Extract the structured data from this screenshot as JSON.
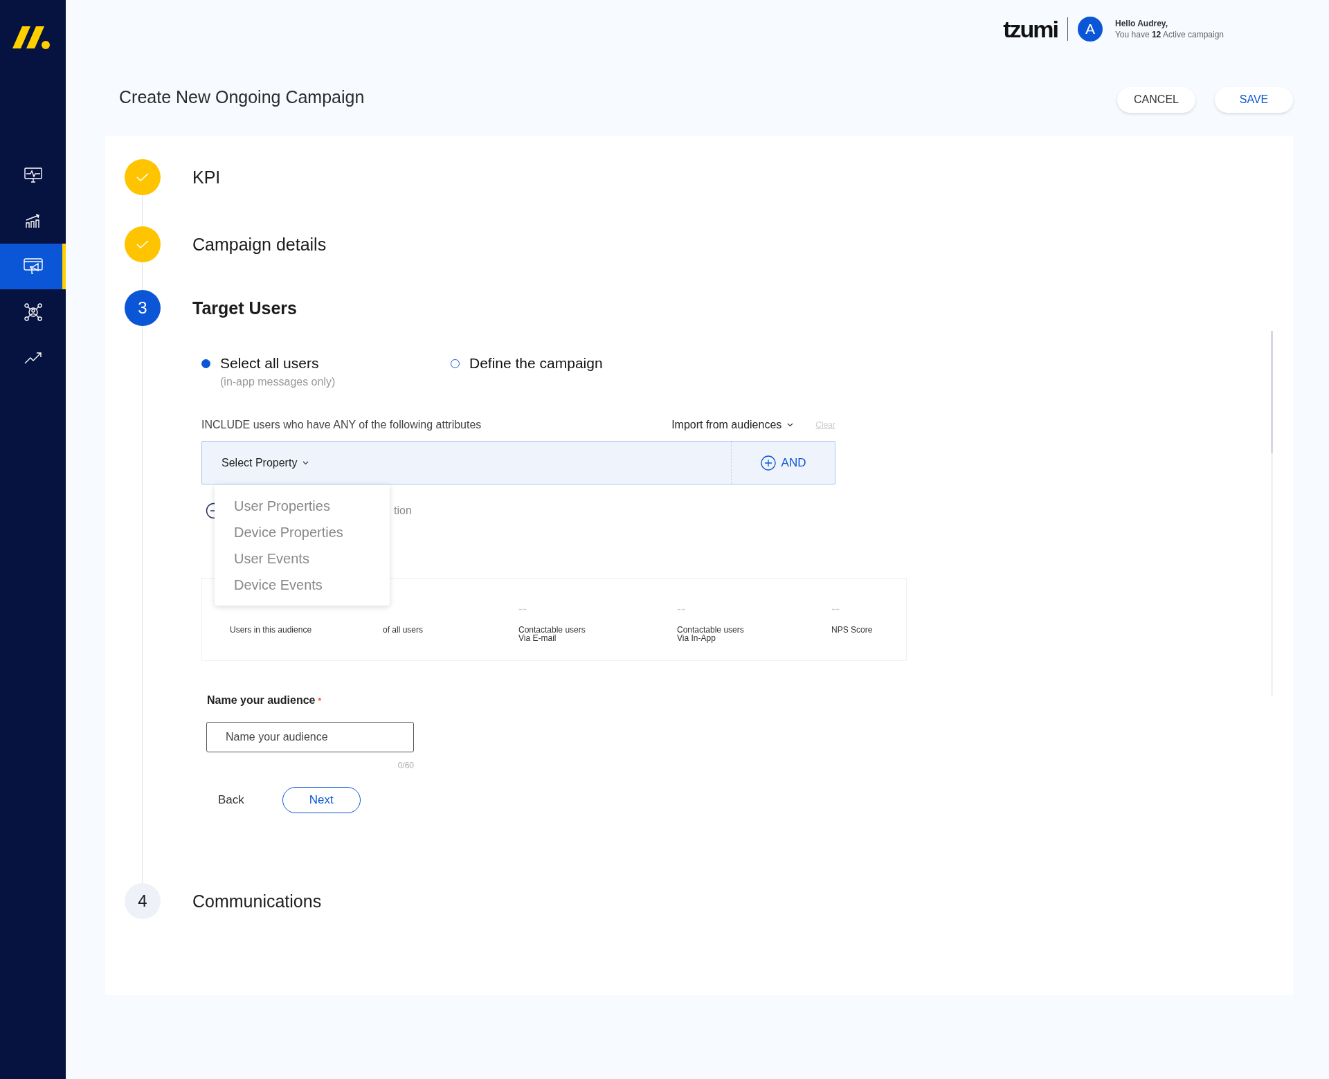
{
  "sidebar": {
    "items": [
      {
        "kind": "monitor",
        "selected": false
      },
      {
        "kind": "chart",
        "selected": false
      },
      {
        "kind": "campaign",
        "selected": true
      },
      {
        "kind": "network",
        "selected": false
      },
      {
        "kind": "trend",
        "selected": false
      }
    ]
  },
  "header": {
    "logo": "tzumi",
    "avatar": "A",
    "greeting": "Hello Audrey,",
    "status": "You have **12** Active campaign"
  },
  "page": {
    "title": "Create New Ongoing Campaign",
    "buttons": [
      {
        "label": "CANCEL",
        "kind": "secondary"
      },
      {
        "label": "SAVE",
        "kind": "primary"
      }
    ]
  },
  "steps": [
    {
      "label": "KPI",
      "kind": "done"
    },
    {
      "label": "Campaign details",
      "kind": "done"
    },
    {
      "number": "3",
      "label": "Target Users",
      "kind": "active"
    },
    {
      "number": "4",
      "label": "Communications",
      "kind": "pending"
    }
  ],
  "target": {
    "options": [
      {
        "label": "Select all users",
        "note": "(in-app messages only)",
        "selected": true
      },
      {
        "label": "Define the campaign",
        "selected": false
      }
    ],
    "include_text": "INCLUDE users who have ANY of the following attributes",
    "import": "Import from audiences",
    "clear": "Clear",
    "select": "Select Property",
    "and": "AND",
    "dropdown": [
      "User Properties",
      "Device Properties",
      "User Events",
      "Device Events"
    ],
    "behind_text": "tion",
    "stats": [
      {
        "lines": [
          "Users in this audience"
        ]
      },
      {
        "lines": [
          "of all users"
        ]
      },
      {
        "value": "--",
        "lines": [
          "Contactable users",
          "Via E-mail"
        ]
      },
      {
        "value": "--",
        "lines": [
          "Contactable users",
          "Via In-App"
        ]
      },
      {
        "value": "--",
        "lines": [
          "NPS Score"
        ]
      }
    ]
  },
  "audience": {
    "label": "Name your audience",
    "required_mark": "*",
    "placeholder": "Name your audience",
    "counter": "0/60",
    "back": "Back",
    "next": "Next"
  }
}
